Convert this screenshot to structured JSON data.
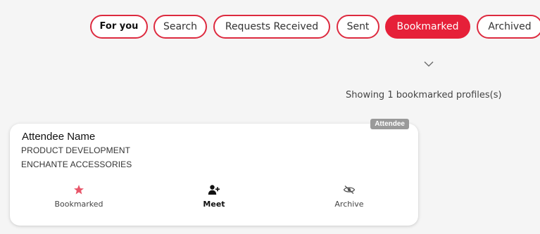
{
  "tabs": [
    {
      "label": "For you",
      "selected": false
    },
    {
      "label": "Search",
      "selected": false
    },
    {
      "label": "Requests Received",
      "selected": false
    },
    {
      "label": "Sent",
      "selected": false
    },
    {
      "label": "Bookmarked",
      "selected": true
    },
    {
      "label": "Archived",
      "selected": false
    }
  ],
  "filter_toggle_icon": "chevron-down-icon",
  "status_text": "Showing 1 bookmarked profiles(s)",
  "profile_card": {
    "badge": "Attendee",
    "name": "Attendee Name",
    "department": "PRODUCT DEVELOPMENT",
    "company": "ENCHANTE ACCESSORIES",
    "actions": [
      {
        "label": "Bookmarked",
        "icon": "star-icon"
      },
      {
        "label": "Meet",
        "icon": "add-user-icon"
      },
      {
        "label": "Archive",
        "icon": "hide-eye-icon"
      }
    ]
  },
  "colors": {
    "accent": "#e62039",
    "border": "#dd2a3f",
    "star": "#e8566a",
    "badge_bg": "#9a9a9a",
    "background": "#f5f5f5"
  }
}
